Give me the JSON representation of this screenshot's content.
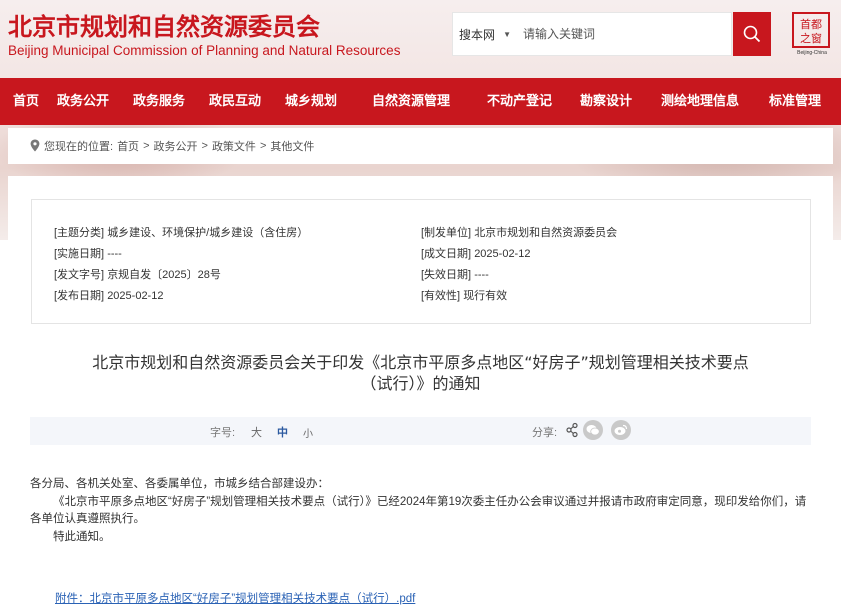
{
  "header": {
    "title": "北京市规划和自然资源委员会",
    "subtitle": "Beijing Municipal Commission of Planning and Natural Resources",
    "search_scope": "搜本网",
    "search_placeholder": "请输入关键词",
    "seal_text": "首都之窗",
    "seal_caption": "Beijing-China",
    "brand_color": "#c8171e"
  },
  "nav": {
    "items": [
      "首页",
      "政务公开",
      "政务服务",
      "政民互动",
      "城乡规划",
      "自然资源管理",
      "不动产登记",
      "勘察设计",
      "测绘地理信息",
      "标准管理"
    ]
  },
  "breadcrumb": {
    "label": "您现在的位置:",
    "items": [
      "首页",
      "政务公开",
      "政策文件",
      "其他文件"
    ],
    "separator": ">"
  },
  "meta": {
    "topic_key": "[主题分类]",
    "topic_value": "城乡建设、环境保护/城乡建设（含住房）",
    "issuer_key": "[制发单位]",
    "issuer_value": "北京市规划和自然资源委员会",
    "effective_key": "[实施日期]",
    "effective_value": "----",
    "created_key": "[成文日期]",
    "created_value": "2025-02-12",
    "docno_key": "[发文字号]",
    "docno_value": "京规自发〔2025〕28号",
    "expiry_key": "[失效日期]",
    "expiry_value": "----",
    "published_key": "[发布日期]",
    "published_value": "2025-02-12",
    "validity_key": "[有效性]",
    "validity_value": "现行有效"
  },
  "article": {
    "title_line1": "北京市规划和自然资源委员会关于印发《北京市平原多点地区“好房子”规划管理相关技术要点",
    "title_line2": "（试行）》的通知",
    "font_size_label": "字号:",
    "font_sizes": [
      "大",
      "中",
      "小"
    ],
    "active_font_size": "中",
    "share_label": "分享:",
    "salutation": "各分局、各机关处室、各委属单位，市城乡结合部建设办：",
    "paragraph1": "《北京市平原多点地区“好房子”规划管理相关技术要点（试行）》已经2024年第19次委主任办公会审议通过并报请市政府审定同意，现印发给你们，请各单位认真遵照执行。",
    "closing": "特此通知。",
    "attachment": "附件：北京市平原多点地区“好房子”规划管理相关技术要点（试行）.pdf"
  }
}
